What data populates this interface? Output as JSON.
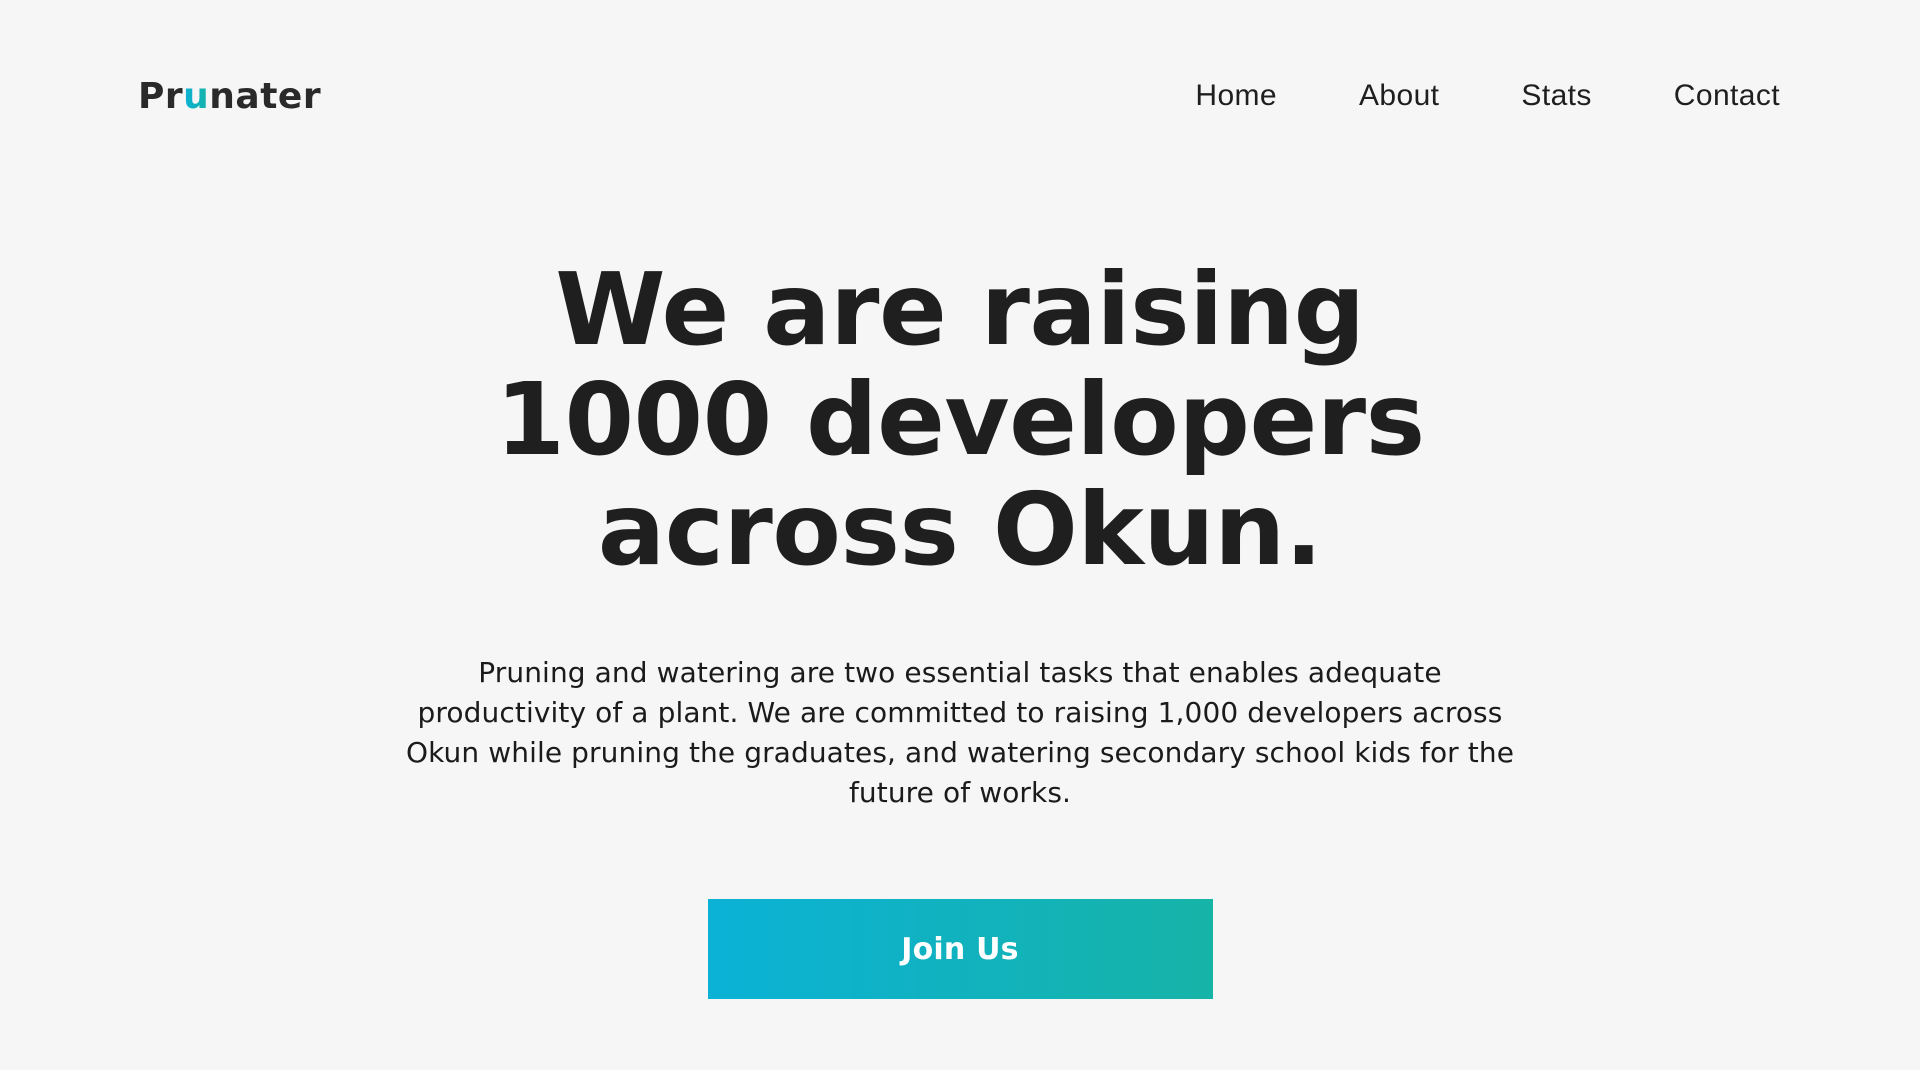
{
  "brand": {
    "prefix": "Pr",
    "accent": "u",
    "suffix": "nater",
    "accent_gradient": [
      "#0bb2d6",
      "#16b3a7"
    ]
  },
  "nav": {
    "items": [
      {
        "label": "Home"
      },
      {
        "label": "About"
      },
      {
        "label": "Stats"
      },
      {
        "label": "Contact"
      }
    ]
  },
  "hero": {
    "title_lines": [
      "We are raising",
      "1000 developers",
      "across Okun."
    ],
    "description": "Pruning and watering are two essential tasks that enables adequate productivity of a plant. We are committed to raising 1,000 developers across Okun while pruning the graduates, and watering secondary school kids for the future of works.",
    "cta_label": "Join Us",
    "cta_gradient": [
      "#0bb2d6",
      "#16b3a7"
    ]
  },
  "colors": {
    "background": "#f6f6f6",
    "text": "#1f1f1f",
    "cta_text": "#ffffff"
  }
}
